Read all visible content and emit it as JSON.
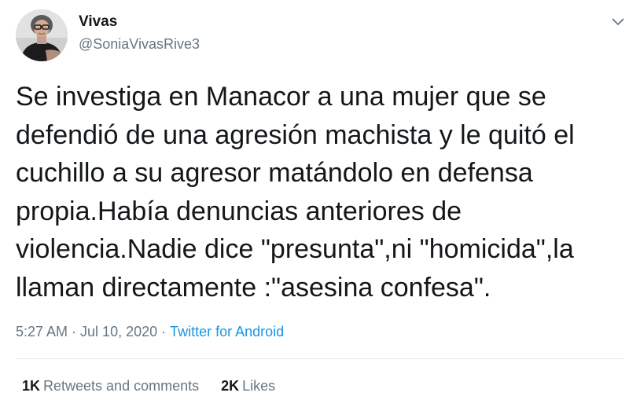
{
  "user": {
    "display_name": "Vivas",
    "handle": "@SoniaVivasRive3",
    "avatar_icon": "profile-photo"
  },
  "tweet": {
    "text": "Se investiga en Manacor a una mujer que se\ndefendió de una agresión machista y le quitó el\ncuchillo a su agresor matándolo en defensa\npropia.Había denuncias anteriores de\nviolencia.Nadie dice \"presunta\",ni \"homicida\",la\nllaman directamente :\"asesina confesa\"."
  },
  "meta": {
    "time": "5:27 AM",
    "separator": "·",
    "date": "Jul 10, 2020",
    "source": "Twitter for Android"
  },
  "stats": {
    "retweets_count": "1K",
    "retweets_label": "Retweets and comments",
    "likes_count": "2K",
    "likes_label": "Likes"
  },
  "colors": {
    "text_primary": "#14171a",
    "text_secondary": "#657786",
    "link": "#1b95e0",
    "divider": "#e6ecf0"
  },
  "icons": {
    "menu": "chevron-down-icon"
  }
}
